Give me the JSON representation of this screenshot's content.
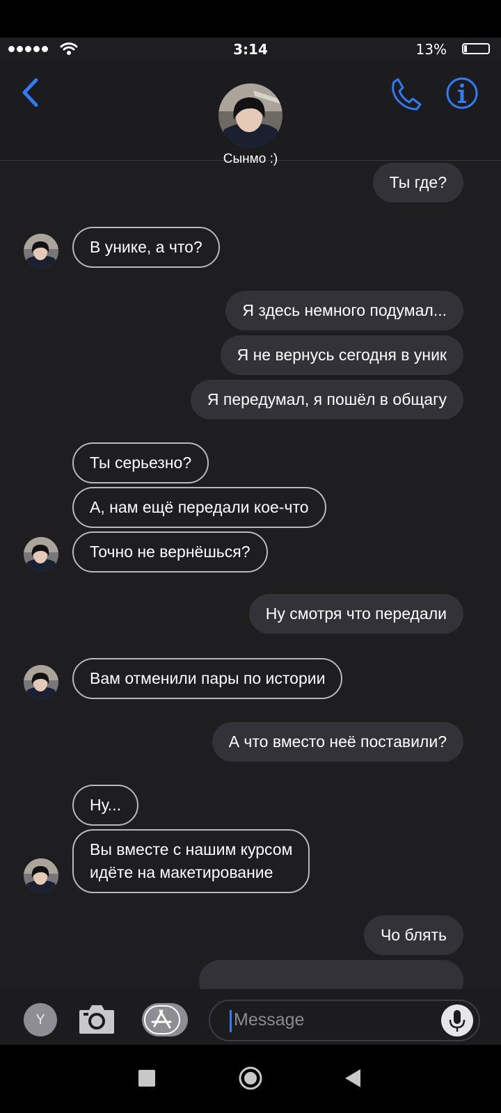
{
  "status": {
    "time": "3:14",
    "battery_pct": "13%",
    "battery_level": 0.13
  },
  "contact": {
    "name": "Сынмо :)"
  },
  "messages": [
    {
      "dir": "out",
      "text": "Ты где?"
    },
    {
      "dir": "in",
      "text": "В унике, а что?"
    },
    {
      "dir": "out",
      "text": "Я здесь немного подумал..."
    },
    {
      "dir": "out",
      "text": "Я не вернусь сегодня в уник"
    },
    {
      "dir": "out",
      "text": "Я передумал, я пошёл в общагу"
    },
    {
      "dir": "in",
      "text": "Ты серьезно?"
    },
    {
      "dir": "in",
      "text": "А, нам ещё передали кое-что"
    },
    {
      "dir": "in",
      "text": "Точно не вернёшься?"
    },
    {
      "dir": "out",
      "text": "Ну смотря что передали"
    },
    {
      "dir": "in",
      "text": "Вам отменили пары по истории"
    },
    {
      "dir": "out",
      "text": "А что вместо неё поставили?"
    },
    {
      "dir": "in",
      "text": "Ну..."
    },
    {
      "dir": "in",
      "lines": [
        "Вы вместе с нашим курсом",
        "идёте на макетирование"
      ]
    },
    {
      "dir": "out",
      "text": "Чо блять"
    }
  ],
  "composer": {
    "profile_letter": "Y",
    "placeholder": "Message"
  },
  "icons": [
    "back-chevron-icon",
    "phone-icon",
    "info-icon",
    "camera-icon",
    "app-store-icon",
    "microphone-icon"
  ],
  "colors": {
    "accent": "#2f7cf6",
    "outgoing_bubble": "#343239",
    "background": "#1e1d20"
  }
}
